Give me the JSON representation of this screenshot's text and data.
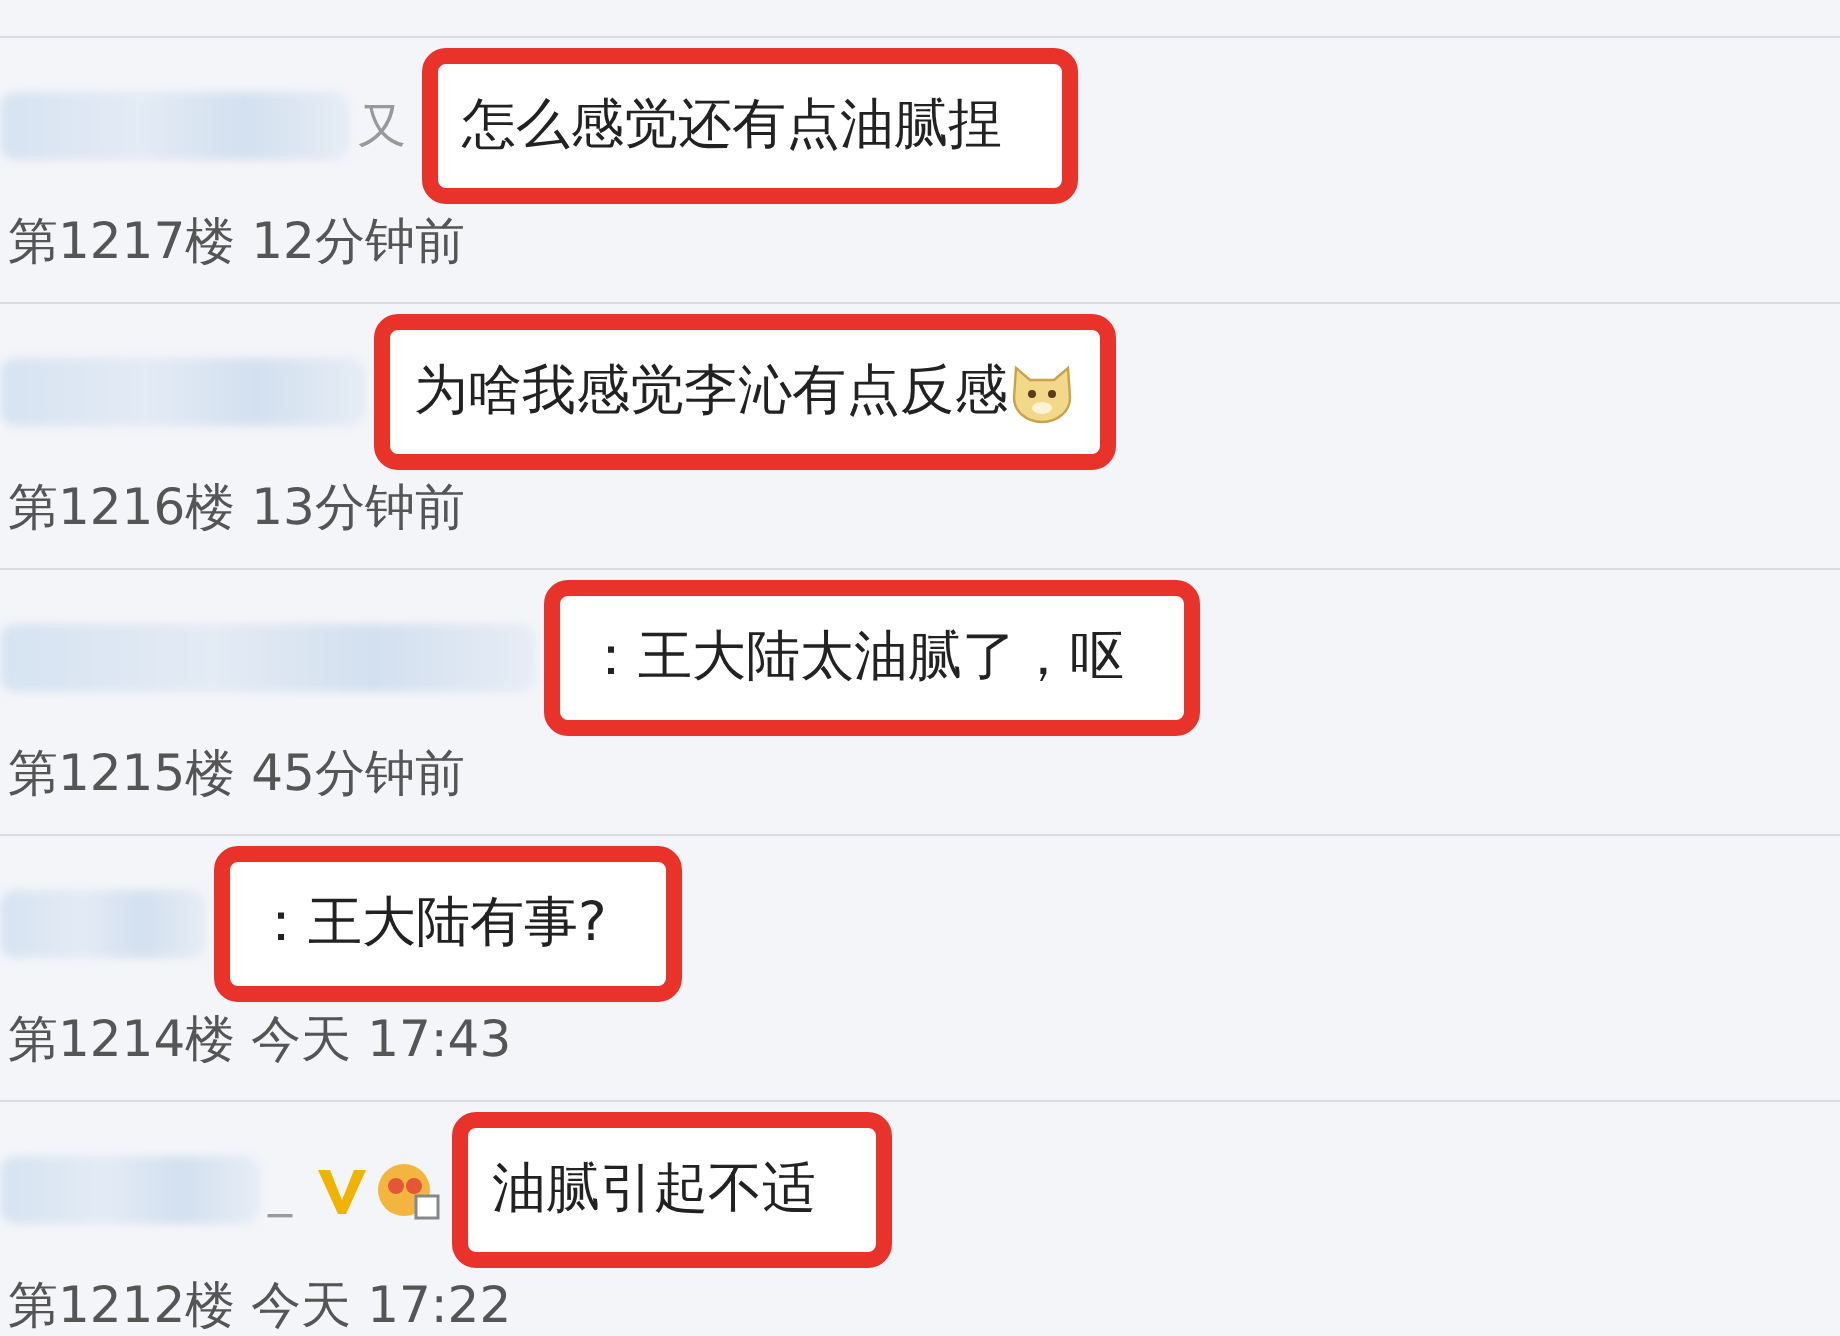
{
  "comments": [
    {
      "name_tail": "又",
      "text": "怎么感觉还有点油腻捏",
      "trailing_emoji": false,
      "verified": false,
      "fan_badge": false,
      "floor": "第1217楼",
      "time": "12分钟前"
    },
    {
      "text": "为啥我感觉李沁有点反感",
      "trailing_emoji": true,
      "verified": false,
      "fan_badge": false,
      "floor": "第1216楼",
      "time": "13分钟前"
    },
    {
      "text": "：王大陆太油腻了，呕",
      "trailing_emoji": false,
      "verified": false,
      "fan_badge": false,
      "floor": "第1215楼",
      "time": "45分钟前"
    },
    {
      "text": "：王大陆有事?",
      "trailing_emoji": false,
      "verified": false,
      "fan_badge": false,
      "floor": "第1214楼",
      "time": "今天 17:43"
    },
    {
      "name_tail": "_",
      "text": "油腻引起不适",
      "trailing_emoji": false,
      "verified": true,
      "fan_badge": true,
      "floor": "第1212楼",
      "time": "今天 17:22"
    }
  ]
}
